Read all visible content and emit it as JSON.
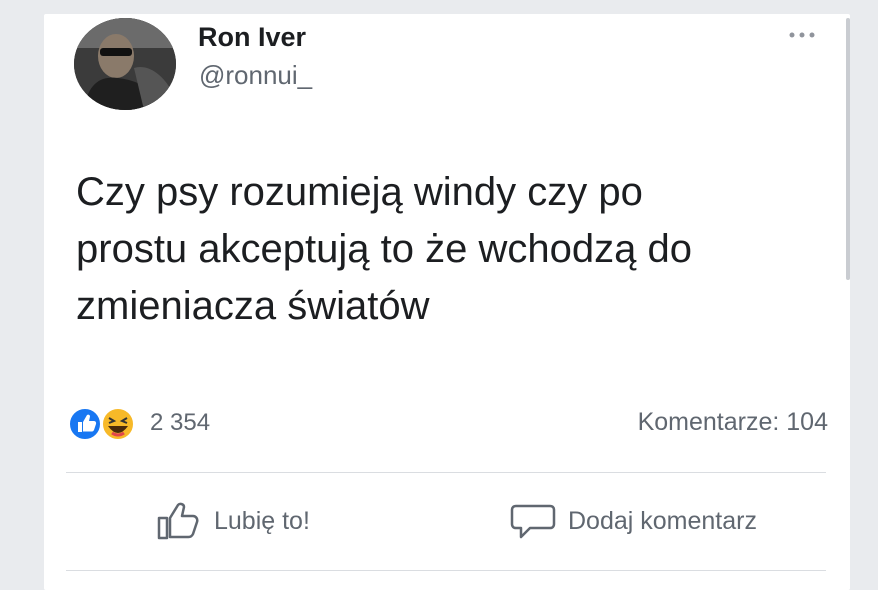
{
  "post": {
    "author_name": "Ron Iver",
    "author_handle": "@ronnui_",
    "text_lines": [
      "Czy psy rozumieją windy czy po",
      "prostu akceptują to że wchodzą do",
      "zmieniacza światów"
    ]
  },
  "stats": {
    "reaction_icons": [
      "like-reaction-icon",
      "haha-reaction-icon"
    ],
    "reaction_count": "2 354",
    "comments": "Komentarze: 104"
  },
  "actions": {
    "like_label": "Lubię to!",
    "comment_label": "Dodaj komentarz"
  },
  "colors": {
    "like_blue": "#1877f2",
    "haha_yellow": "#f7b928",
    "secondary_text": "#606770",
    "primary_text": "#1c1e21"
  }
}
